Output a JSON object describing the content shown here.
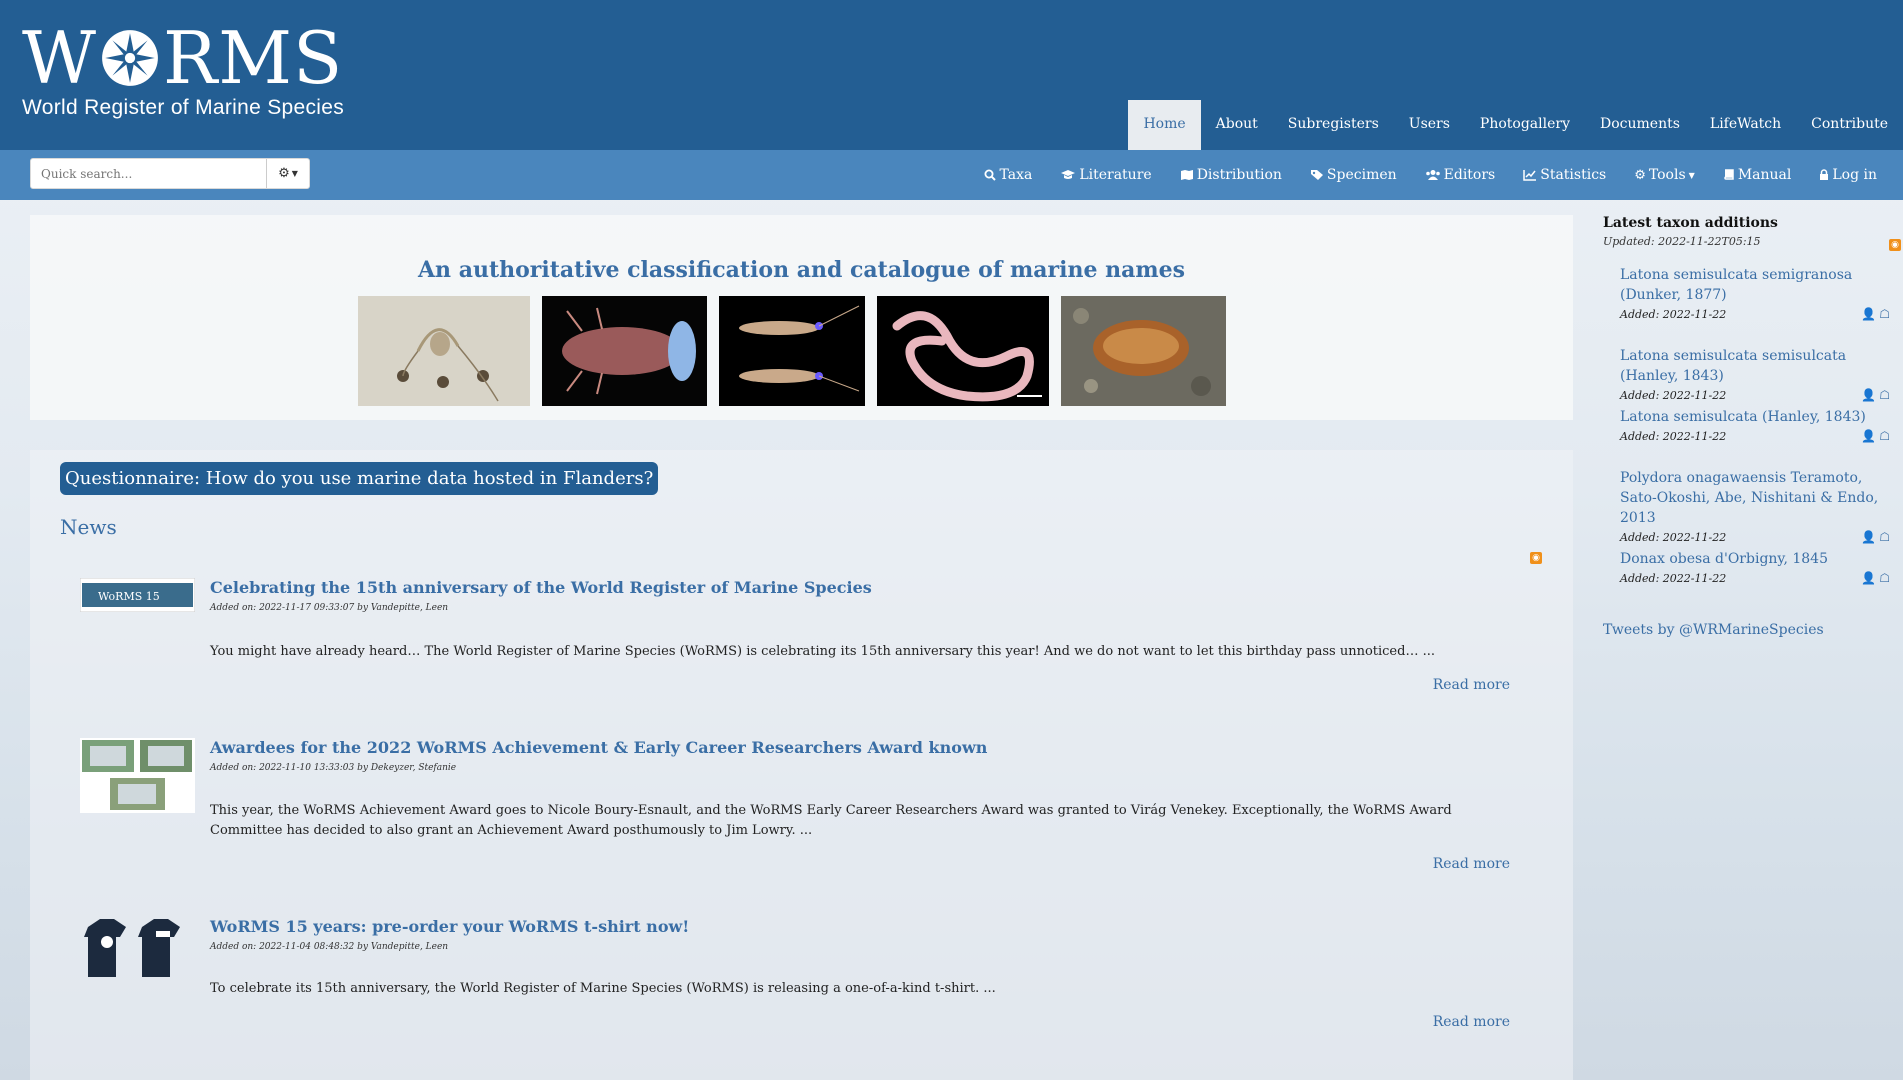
{
  "header": {
    "logo_word_left": "W",
    "logo_word_right": "RMS",
    "logo_subtitle": "World Register of Marine Species",
    "nav": [
      "Home",
      "About",
      "Subregisters",
      "Users",
      "Photogallery",
      "Documents",
      "LifeWatch",
      "Contribute"
    ],
    "active_nav": "Home"
  },
  "toolbar": {
    "search_placeholder": "Quick search...",
    "search_options_icon": "gear-icon",
    "items": [
      {
        "icon": "search-icon",
        "label": "Taxa"
      },
      {
        "icon": "graduation-cap-icon",
        "label": "Literature"
      },
      {
        "icon": "map-icon",
        "label": "Distribution"
      },
      {
        "icon": "tag-icon",
        "label": "Specimen"
      },
      {
        "icon": "users-icon",
        "label": "Editors"
      },
      {
        "icon": "chart-icon",
        "label": "Statistics"
      },
      {
        "icon": "cogs-icon",
        "label": "Tools"
      },
      {
        "icon": "book-icon",
        "label": "Manual"
      },
      {
        "icon": "lock-icon",
        "label": "Log in"
      }
    ]
  },
  "hero": {
    "tagline": "An authoritative classification and catalogue of marine names"
  },
  "main": {
    "questionnaire": "Questionnaire: How do you use marine data hosted in Flanders?",
    "news_heading": "News",
    "articles": [
      {
        "title": "Celebrating the 15th anniversary of the World Register of Marine Species",
        "meta": "Added on: 2022-11-17 09:33:07 by Vandepitte, Leen",
        "body": "You might have already heard… The World Register of Marine Species (WoRMS) is celebrating its 15th anniversary this year! And we do not want to let this birthday pass unnoticed… ...",
        "read_more": "Read more",
        "thumb_text": "WoRMS 15"
      },
      {
        "title": "Awardees for the 2022 WoRMS Achievement & Early Career Researchers Award known",
        "meta": "Added on: 2022-11-10 13:33:03 by Dekeyzer, Stefanie",
        "body": "This year, the WoRMS Achievement Award goes to Nicole Boury-Esnault, and the WoRMS Early Career Researchers Award was granted to Virág Venekey. Exceptionally, the WoRMS Award Committee has decided to also grant an Achievement Award posthumously to Jim Lowry. ...",
        "read_more": "Read more"
      },
      {
        "title": "WoRMS 15 years: pre-order your WoRMS t-shirt now!",
        "meta": "Added on: 2022-11-04 08:48:32 by Vandepitte, Leen",
        "body": "To celebrate its 15th anniversary, the World Register of Marine Species (WoRMS) is releasing a one-of-a-kind t-shirt. ...",
        "read_more": "Read more"
      }
    ]
  },
  "sidebar": {
    "heading": "Latest taxon additions",
    "updated": "Updated: 2022-11-22T05:15",
    "taxa": [
      {
        "name": "Latona semisulcata semigranosa (Dunker, 1877)",
        "added": "Added: 2022-11-22"
      },
      {
        "name": "Latona semisulcata semisulcata (Hanley, 1843)",
        "added": "Added: 2022-11-22"
      },
      {
        "name": "Latona semisulcata (Hanley, 1843)",
        "added": "Added: 2022-11-22"
      },
      {
        "name": "Polydora onagawaensis Teramoto, Sato-Okoshi, Abe, Nishitani & Endo, 2013",
        "added": "Added: 2022-11-22"
      },
      {
        "name": "Donax obesa d'Orbigny, 1845",
        "added": "Added: 2022-11-22"
      }
    ],
    "tweets": "Tweets by @WRMarineSpecies"
  },
  "colors": {
    "header": "#235e93",
    "subbar": "#4a86bd",
    "link": "#3a6ea5",
    "rss": "#f0901a"
  }
}
